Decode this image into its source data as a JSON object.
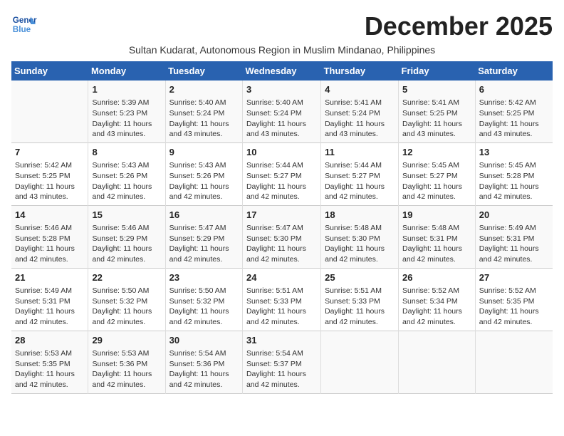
{
  "logo": {
    "line1": "General",
    "line2": "Blue"
  },
  "title": "December 2025",
  "subtitle": "Sultan Kudarat, Autonomous Region in Muslim Mindanao, Philippines",
  "days_of_week": [
    "Sunday",
    "Monday",
    "Tuesday",
    "Wednesday",
    "Thursday",
    "Friday",
    "Saturday"
  ],
  "weeks": [
    [
      {
        "num": "",
        "info": ""
      },
      {
        "num": "1",
        "info": "Sunrise: 5:39 AM\nSunset: 5:23 PM\nDaylight: 11 hours\nand 43 minutes."
      },
      {
        "num": "2",
        "info": "Sunrise: 5:40 AM\nSunset: 5:24 PM\nDaylight: 11 hours\nand 43 minutes."
      },
      {
        "num": "3",
        "info": "Sunrise: 5:40 AM\nSunset: 5:24 PM\nDaylight: 11 hours\nand 43 minutes."
      },
      {
        "num": "4",
        "info": "Sunrise: 5:41 AM\nSunset: 5:24 PM\nDaylight: 11 hours\nand 43 minutes."
      },
      {
        "num": "5",
        "info": "Sunrise: 5:41 AM\nSunset: 5:25 PM\nDaylight: 11 hours\nand 43 minutes."
      },
      {
        "num": "6",
        "info": "Sunrise: 5:42 AM\nSunset: 5:25 PM\nDaylight: 11 hours\nand 43 minutes."
      }
    ],
    [
      {
        "num": "7",
        "info": "Sunrise: 5:42 AM\nSunset: 5:25 PM\nDaylight: 11 hours\nand 43 minutes."
      },
      {
        "num": "8",
        "info": "Sunrise: 5:43 AM\nSunset: 5:26 PM\nDaylight: 11 hours\nand 42 minutes."
      },
      {
        "num": "9",
        "info": "Sunrise: 5:43 AM\nSunset: 5:26 PM\nDaylight: 11 hours\nand 42 minutes."
      },
      {
        "num": "10",
        "info": "Sunrise: 5:44 AM\nSunset: 5:27 PM\nDaylight: 11 hours\nand 42 minutes."
      },
      {
        "num": "11",
        "info": "Sunrise: 5:44 AM\nSunset: 5:27 PM\nDaylight: 11 hours\nand 42 minutes."
      },
      {
        "num": "12",
        "info": "Sunrise: 5:45 AM\nSunset: 5:27 PM\nDaylight: 11 hours\nand 42 minutes."
      },
      {
        "num": "13",
        "info": "Sunrise: 5:45 AM\nSunset: 5:28 PM\nDaylight: 11 hours\nand 42 minutes."
      }
    ],
    [
      {
        "num": "14",
        "info": "Sunrise: 5:46 AM\nSunset: 5:28 PM\nDaylight: 11 hours\nand 42 minutes."
      },
      {
        "num": "15",
        "info": "Sunrise: 5:46 AM\nSunset: 5:29 PM\nDaylight: 11 hours\nand 42 minutes."
      },
      {
        "num": "16",
        "info": "Sunrise: 5:47 AM\nSunset: 5:29 PM\nDaylight: 11 hours\nand 42 minutes."
      },
      {
        "num": "17",
        "info": "Sunrise: 5:47 AM\nSunset: 5:30 PM\nDaylight: 11 hours\nand 42 minutes."
      },
      {
        "num": "18",
        "info": "Sunrise: 5:48 AM\nSunset: 5:30 PM\nDaylight: 11 hours\nand 42 minutes."
      },
      {
        "num": "19",
        "info": "Sunrise: 5:48 AM\nSunset: 5:31 PM\nDaylight: 11 hours\nand 42 minutes."
      },
      {
        "num": "20",
        "info": "Sunrise: 5:49 AM\nSunset: 5:31 PM\nDaylight: 11 hours\nand 42 minutes."
      }
    ],
    [
      {
        "num": "21",
        "info": "Sunrise: 5:49 AM\nSunset: 5:31 PM\nDaylight: 11 hours\nand 42 minutes."
      },
      {
        "num": "22",
        "info": "Sunrise: 5:50 AM\nSunset: 5:32 PM\nDaylight: 11 hours\nand 42 minutes."
      },
      {
        "num": "23",
        "info": "Sunrise: 5:50 AM\nSunset: 5:32 PM\nDaylight: 11 hours\nand 42 minutes."
      },
      {
        "num": "24",
        "info": "Sunrise: 5:51 AM\nSunset: 5:33 PM\nDaylight: 11 hours\nand 42 minutes."
      },
      {
        "num": "25",
        "info": "Sunrise: 5:51 AM\nSunset: 5:33 PM\nDaylight: 11 hours\nand 42 minutes."
      },
      {
        "num": "26",
        "info": "Sunrise: 5:52 AM\nSunset: 5:34 PM\nDaylight: 11 hours\nand 42 minutes."
      },
      {
        "num": "27",
        "info": "Sunrise: 5:52 AM\nSunset: 5:35 PM\nDaylight: 11 hours\nand 42 minutes."
      }
    ],
    [
      {
        "num": "28",
        "info": "Sunrise: 5:53 AM\nSunset: 5:35 PM\nDaylight: 11 hours\nand 42 minutes."
      },
      {
        "num": "29",
        "info": "Sunrise: 5:53 AM\nSunset: 5:36 PM\nDaylight: 11 hours\nand 42 minutes."
      },
      {
        "num": "30",
        "info": "Sunrise: 5:54 AM\nSunset: 5:36 PM\nDaylight: 11 hours\nand 42 minutes."
      },
      {
        "num": "31",
        "info": "Sunrise: 5:54 AM\nSunset: 5:37 PM\nDaylight: 11 hours\nand 42 minutes."
      },
      {
        "num": "",
        "info": ""
      },
      {
        "num": "",
        "info": ""
      },
      {
        "num": "",
        "info": ""
      }
    ]
  ]
}
